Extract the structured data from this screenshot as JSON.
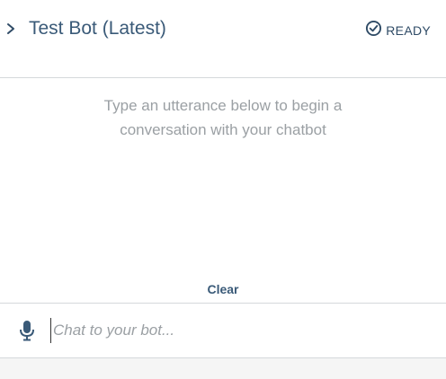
{
  "header": {
    "collapse_icon": "chevron-right-icon",
    "title": "Test Bot (Latest)",
    "status_icon": "check-circle-icon",
    "status_label": "READY"
  },
  "conversation": {
    "empty_message": "Type an utterance below to begin a conversation with your chatbot"
  },
  "actions": {
    "clear_label": "Clear"
  },
  "input": {
    "mic_icon": "microphone-icon",
    "placeholder": "Chat to your bot...",
    "value": ""
  },
  "colors": {
    "title": "#3a5a78",
    "status": "#2f4b66",
    "muted_text": "#9ba0a4",
    "divider": "#d5d8db",
    "footer_bg": "#f5f5f5"
  }
}
